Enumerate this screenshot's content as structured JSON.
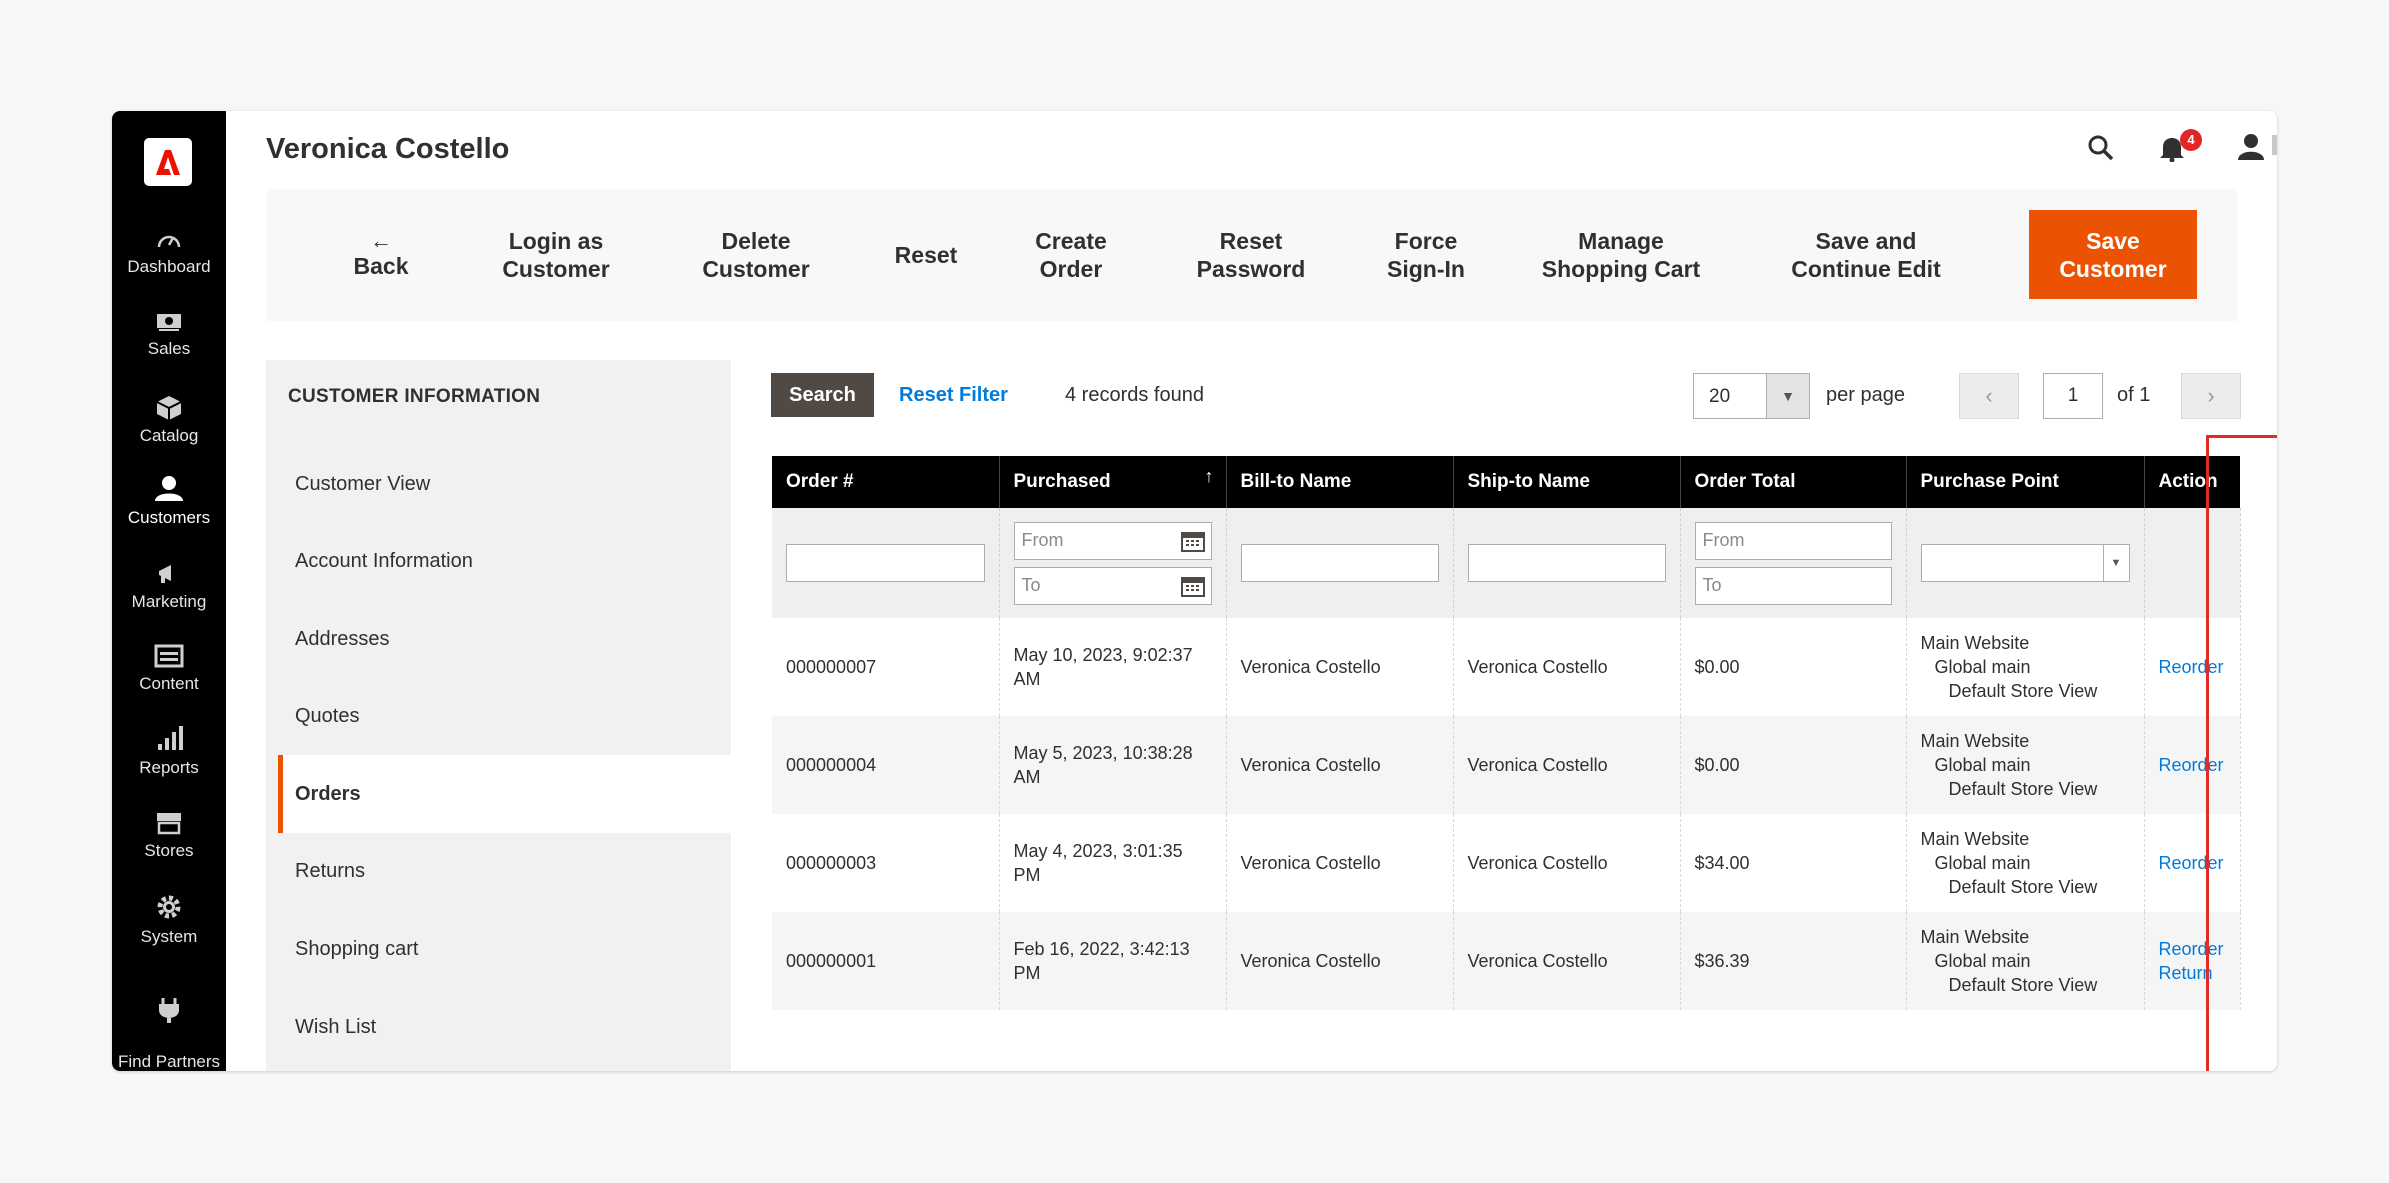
{
  "app": {
    "page_title": "Veronica Costello",
    "notification_count": "4",
    "accent_color": "#eb5202",
    "link_color": "#007bdb"
  },
  "sidebar": {
    "items": [
      {
        "label": "Dashboard",
        "icon": "dashboard-icon"
      },
      {
        "label": "Sales",
        "icon": "sales-icon"
      },
      {
        "label": "Catalog",
        "icon": "catalog-icon"
      },
      {
        "label": "Customers",
        "icon": "customers-icon"
      },
      {
        "label": "Marketing",
        "icon": "marketing-icon"
      },
      {
        "label": "Content",
        "icon": "content-icon"
      },
      {
        "label": "Reports",
        "icon": "reports-icon"
      },
      {
        "label": "Stores",
        "icon": "stores-icon"
      },
      {
        "label": "System",
        "icon": "system-icon"
      },
      {
        "label": "Find Partners\n& Extensions",
        "icon": "partners-icon"
      }
    ]
  },
  "toolbar": {
    "back": "Back",
    "login_as_customer": "Login as\nCustomer",
    "delete_customer": "Delete\nCustomer",
    "reset": "Reset",
    "create_order": "Create\nOrder",
    "reset_password": "Reset\nPassword",
    "force_signin": "Force\nSign-In",
    "manage_cart": "Manage\nShopping Cart",
    "save_continue": "Save and\nContinue Edit",
    "save_customer": "Save\nCustomer"
  },
  "tabs": {
    "title": "CUSTOMER INFORMATION",
    "items": [
      "Customer View",
      "Account Information",
      "Addresses",
      "Quotes",
      "Orders",
      "Returns",
      "Shopping cart",
      "Wish List"
    ],
    "active": "Orders"
  },
  "grid": {
    "search_label": "Search",
    "reset_filter_label": "Reset Filter",
    "records_found": "4 records found",
    "per_page_value": "20",
    "per_page_label": "per page",
    "current_page": "1",
    "page_of": "of 1",
    "columns": [
      "Order #",
      "Purchased",
      "Bill-to Name",
      "Ship-to Name",
      "Order Total",
      "Purchase Point",
      "Action"
    ],
    "filters": {
      "purchased_from_placeholder": "From",
      "purchased_to_placeholder": "To",
      "total_from_placeholder": "From",
      "total_to_placeholder": "To"
    },
    "rows": [
      {
        "order": "000000007",
        "purchased": "May 10, 2023, 9:02:37 AM",
        "bill_to": "Veronica Costello",
        "ship_to": "Veronica Costello",
        "total": "$0.00",
        "pp1": "Main Website",
        "pp2": "Global main",
        "pp3": "Default Store View",
        "action1": "Reorder",
        "action2": ""
      },
      {
        "order": "000000004",
        "purchased": "May 5, 2023, 10:38:28 AM",
        "bill_to": "Veronica Costello",
        "ship_to": "Veronica Costello",
        "total": "$0.00",
        "pp1": "Main Website",
        "pp2": "Global main",
        "pp3": "Default Store View",
        "action1": "Reorder",
        "action2": ""
      },
      {
        "order": "000000003",
        "purchased": "May 4, 2023, 3:01:35 PM",
        "bill_to": "Veronica Costello",
        "ship_to": "Veronica Costello",
        "total": "$34.00",
        "pp1": "Main Website",
        "pp2": "Global main",
        "pp3": "Default Store View",
        "action1": "Reorder",
        "action2": ""
      },
      {
        "order": "000000001",
        "purchased": "Feb 16, 2022, 3:42:13 PM",
        "bill_to": "Veronica Costello",
        "ship_to": "Veronica Costello",
        "total": "$36.39",
        "pp1": "Main Website",
        "pp2": "Global main",
        "pp3": "Default Store View",
        "action1": "Reorder",
        "action2": "Return"
      }
    ]
  }
}
